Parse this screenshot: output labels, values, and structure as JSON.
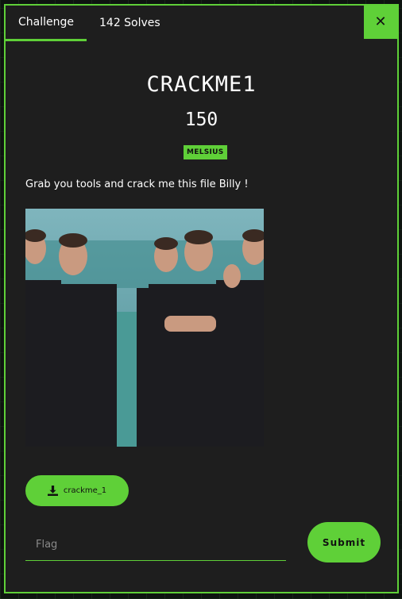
{
  "tabs": [
    {
      "label": "Challenge",
      "active": true
    },
    {
      "label": "142 Solves",
      "active": false
    }
  ],
  "close_icon": "close-icon",
  "challenge": {
    "name": "CRACKME1",
    "points": "150",
    "author": "MELSIUS",
    "description": "Grab you tools and crack me this file Billy !"
  },
  "file": {
    "icon": "download-icon",
    "label": "crackme_1"
  },
  "flag": {
    "placeholder": "Flag",
    "value": ""
  },
  "submit": {
    "label": "Submit"
  },
  "colors": {
    "accent": "#5fd038",
    "modal_bg": "#1e1e1e"
  }
}
